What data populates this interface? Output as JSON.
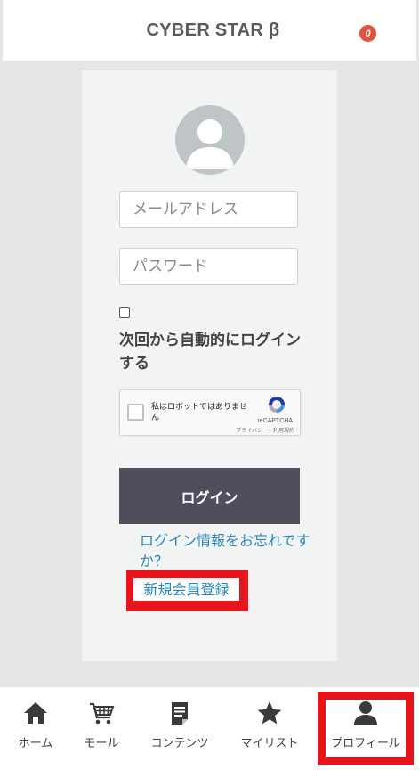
{
  "header": {
    "title": "CYBER STAR β",
    "cart_count": "0"
  },
  "login_form": {
    "email_placeholder": "メールアドレス",
    "password_placeholder": "パスワード",
    "remember_label": "次回から自動的にログインする",
    "recaptcha": {
      "label": "私はロボットではありません",
      "brand": "reCAPTCHA",
      "links": "プライバシー - 利用規約"
    },
    "login_button": "ログイン",
    "forgot_link": "ログイン情報をお忘れですか？",
    "register_link": "新規会員登録"
  },
  "bottom_nav": {
    "items": [
      {
        "label": "ホーム",
        "icon": "home-icon"
      },
      {
        "label": "モール",
        "icon": "cart-icon"
      },
      {
        "label": "コンテンツ",
        "icon": "document-icon"
      },
      {
        "label": "マイリスト",
        "icon": "star-icon"
      },
      {
        "label": "プロフィール",
        "icon": "person-icon"
      }
    ]
  },
  "colors": {
    "highlight": "#e8141c",
    "link": "#2a86b8",
    "button": "#4f4e5c",
    "badge": "#e0533f"
  }
}
